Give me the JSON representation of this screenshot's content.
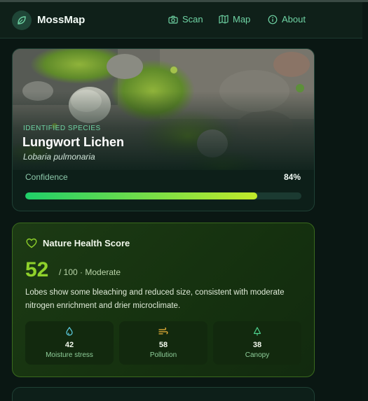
{
  "app": {
    "name": "MossMap"
  },
  "nav": [
    {
      "label": "Scan",
      "icon": "camera-icon"
    },
    {
      "label": "Map",
      "icon": "map-icon"
    },
    {
      "label": "About",
      "icon": "info-icon"
    }
  ],
  "species": {
    "section_label": "IDENTIFIED SPECIES",
    "common_name": "Lungwort Lichen",
    "scientific_name": "Lobaria pulmonaria",
    "confidence_label": "Confidence",
    "confidence_value": "84%",
    "confidence_fraction": 0.84
  },
  "health": {
    "title": "Nature Health Score",
    "score": "52",
    "score_suffix": "/ 100 · Moderate",
    "description": "Lobes show some bleaching and reduced size, consistent with moderate nitrogen enrichment and drier microclimate.",
    "metrics": [
      {
        "value": "42",
        "label": "Moisture stress",
        "icon": "droplet-icon",
        "color": "#5fd0e6"
      },
      {
        "value": "58",
        "label": "Pollution",
        "icon": "wind-icon",
        "color": "#f0b53a"
      },
      {
        "value": "38",
        "label": "Canopy",
        "icon": "tree-icon",
        "color": "#4fd38f"
      }
    ]
  },
  "colors": {
    "accent": "#6fd3a4",
    "score": "#8fd12b",
    "bar_start": "#1fcf69",
    "bar_end": "#c2ea2a"
  }
}
